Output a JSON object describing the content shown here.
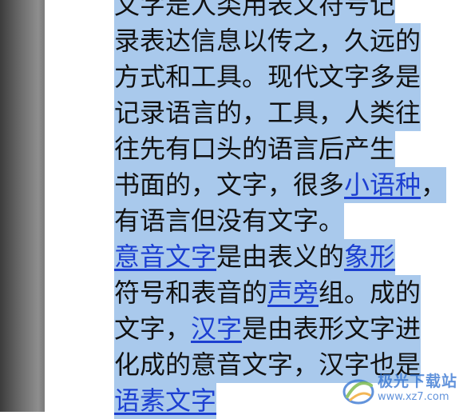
{
  "document": {
    "lines": [
      {
        "segments": [
          {
            "text": "文字是人类用表义符号记",
            "link": false
          }
        ]
      },
      {
        "segments": [
          {
            "text": "录表达信息以传之，久远的",
            "link": false
          }
        ]
      },
      {
        "segments": [
          {
            "text": "方式和工具。现代文字多是",
            "link": false
          }
        ]
      },
      {
        "segments": [
          {
            "text": "记录语言的，工具，人类往",
            "link": false
          }
        ]
      },
      {
        "segments": [
          {
            "text": "往先有口头的语言后产生",
            "link": false
          }
        ]
      },
      {
        "segments": [
          {
            "text": "书面的，文字，很多",
            "link": false
          },
          {
            "text": "小语种",
            "link": true
          },
          {
            "text": "，",
            "link": false
          }
        ]
      },
      {
        "segments": [
          {
            "text": "有语言但没有文字。",
            "link": false
          }
        ]
      },
      {
        "segments": [
          {
            "text": "意音文字",
            "link": true
          },
          {
            "text": "是由表义的",
            "link": false
          },
          {
            "text": "象形",
            "link": true
          }
        ]
      },
      {
        "segments": [
          {
            "text": "符号和表音的",
            "link": false
          },
          {
            "text": "声旁",
            "link": true
          },
          {
            "text": "组。成的",
            "link": false
          }
        ]
      },
      {
        "segments": [
          {
            "text": "文字，",
            "link": false
          },
          {
            "text": "汉字",
            "link": true
          },
          {
            "text": "是由表形文字进",
            "link": false
          }
        ]
      },
      {
        "segments": [
          {
            "text": "化成的意音文字，汉字也是",
            "link": false
          }
        ]
      },
      {
        "segments": [
          {
            "text": "语素文字",
            "link": true
          }
        ]
      }
    ],
    "selection_color": "#a9c9ec",
    "link_color": "#1c3fd1",
    "text_color": "#111111"
  },
  "watermark": {
    "title": "极光下载站",
    "url": "www.xz7.com",
    "logo_icon": "aurora-logo-icon",
    "color": "#2e6fcf"
  }
}
